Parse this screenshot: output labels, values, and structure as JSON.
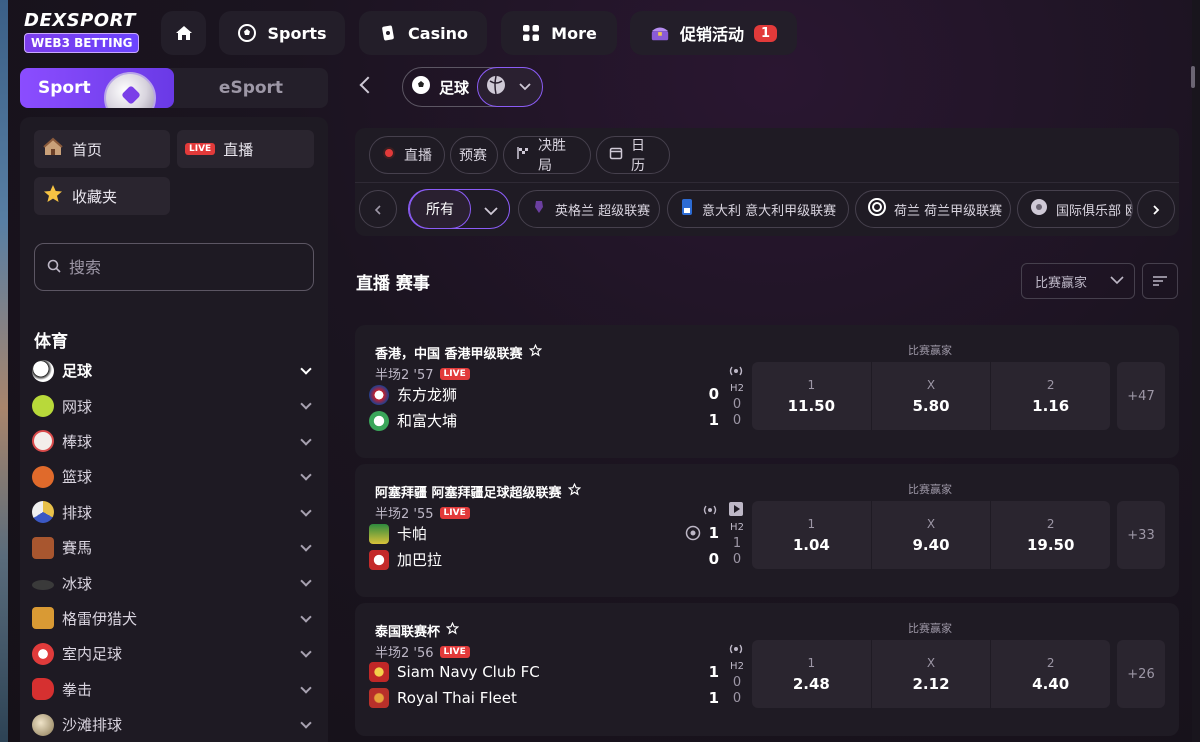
{
  "brand": {
    "word": "DEXSPORT",
    "badge": "WEB3 BETTING"
  },
  "nav": {
    "sports": "Sports",
    "casino": "Casino",
    "more": "More",
    "promo": "促销活动",
    "promo_count": "1"
  },
  "toggle": {
    "sport": "Sport",
    "esport": "eSport"
  },
  "quick": {
    "home": "首页",
    "live": "直播",
    "live_tag": "LIVE",
    "favorites": "收藏夹"
  },
  "search": {
    "placeholder": "搜索"
  },
  "sports_heading": "体育",
  "sports": [
    {
      "label": "足球",
      "icon": "soccer-ball-icon",
      "color": "#f2f2f2"
    },
    {
      "label": "网球",
      "icon": "tennis-ball-icon",
      "color": "#b8d93a"
    },
    {
      "label": "棒球",
      "icon": "baseball-icon",
      "color": "#f3eeea"
    },
    {
      "label": "篮球",
      "icon": "basketball-icon",
      "color": "#e06a2b"
    },
    {
      "label": "排球",
      "icon": "volleyball-icon",
      "color": "#e8c14a"
    },
    {
      "label": "賽馬",
      "icon": "horse-racing-icon",
      "color": "#a8562f"
    },
    {
      "label": "冰球",
      "icon": "ice-hockey-icon",
      "color": "#3a3a3a"
    },
    {
      "label": "格雷伊猎犬",
      "icon": "greyhound-icon",
      "color": "#d99a34"
    },
    {
      "label": "室内足球",
      "icon": "futsal-icon",
      "color": "#e03b3b"
    },
    {
      "label": "拳击",
      "icon": "boxing-glove-icon",
      "color": "#d63030"
    },
    {
      "label": "沙滩排球",
      "icon": "beach-volleyball-icon",
      "color": "#c9b48a"
    }
  ],
  "current_sport": "足球",
  "filters": {
    "live": "直播",
    "prematch": "预赛",
    "outright": "决胜局",
    "calendar": "日历"
  },
  "league_filter": {
    "all": "所有"
  },
  "leagues": [
    "英格兰 超级联赛",
    "意大利 意大利甲级联赛",
    "荷兰 荷兰甲级联赛",
    "国际俱乐部 欧"
  ],
  "section_title": "直播 赛事",
  "market_select": "比赛赢家",
  "matches": [
    {
      "league": "香港，中国 香港甲级联赛",
      "market": "比赛赢家",
      "time": "半场2 '57",
      "live": "LIVE",
      "h2_label": "H2",
      "team1": "东方龙狮",
      "score1": "0",
      "h2_1": "0",
      "team2": "和富大埔",
      "score2": "1",
      "h2_2": "0",
      "odds": [
        {
          "label": "1",
          "value": "11.50"
        },
        {
          "label": "X",
          "value": "5.80"
        },
        {
          "label": "2",
          "value": "1.16"
        }
      ],
      "more": "+47"
    },
    {
      "league": "阿塞拜疆 阿塞拜疆足球超级联赛",
      "market": "比赛赢家",
      "time": "半场2 '55",
      "live": "LIVE",
      "h2_label": "H2",
      "team1": "卡帕",
      "score1": "1",
      "h2_1": "1",
      "team2": "加巴拉",
      "score2": "0",
      "h2_2": "0",
      "odds": [
        {
          "label": "1",
          "value": "1.04"
        },
        {
          "label": "X",
          "value": "9.40"
        },
        {
          "label": "2",
          "value": "19.50"
        }
      ],
      "more": "+33"
    },
    {
      "league": "泰国联赛杯",
      "market": "比赛赢家",
      "time": "半场2 '56",
      "live": "LIVE",
      "h2_label": "H2",
      "team1": "Siam Navy Club FC",
      "score1": "1",
      "h2_1": "0",
      "team2": "Royal Thai Fleet",
      "score2": "1",
      "h2_2": "0",
      "odds": [
        {
          "label": "1",
          "value": "2.48"
        },
        {
          "label": "X",
          "value": "2.12"
        },
        {
          "label": "2",
          "value": "4.40"
        }
      ],
      "more": "+26"
    }
  ],
  "colors": {
    "accent": "#8b5cf6",
    "live_red": "#e23a3a",
    "card": "#1f1b24"
  }
}
